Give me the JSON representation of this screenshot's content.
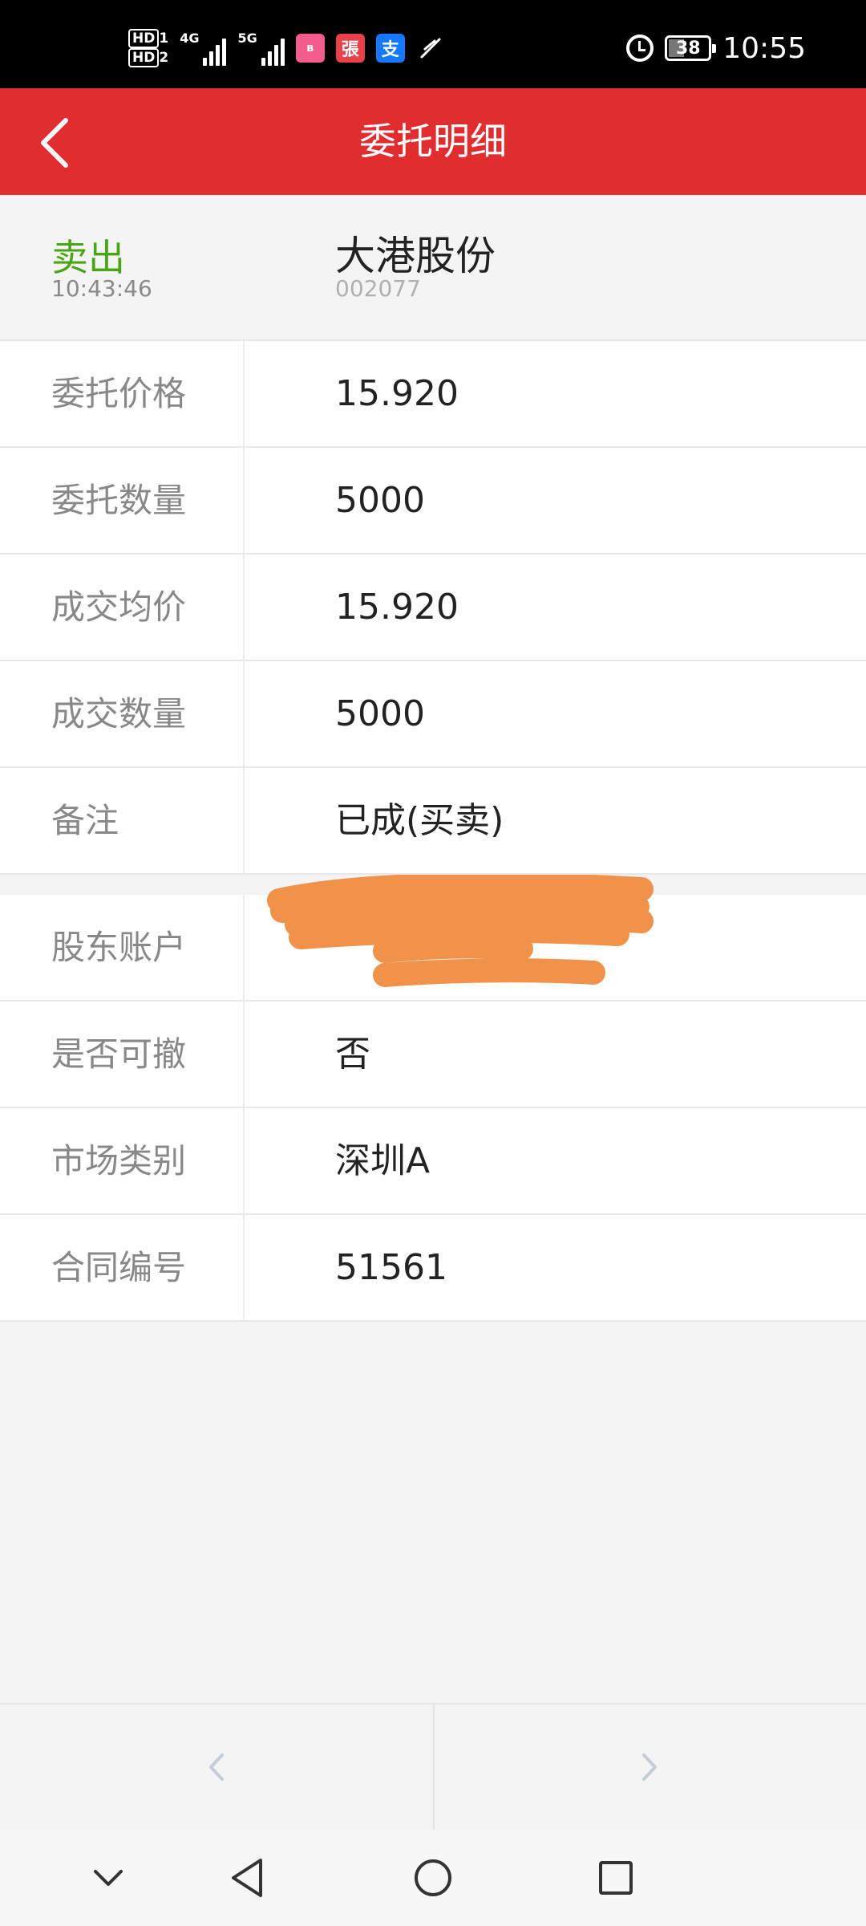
{
  "status_bar": {
    "hd1": "HD",
    "hd1_sub": "1",
    "hd2": "HD",
    "hd2_sub": "2",
    "net1": "4G",
    "net2": "5G",
    "app_icons": [
      "bilibili-icon",
      "zhang-app-icon",
      "alipay-icon",
      "feather-icon"
    ],
    "battery": "38",
    "time": "10:55"
  },
  "header": {
    "title": "委托明细",
    "back_icon": "chevron-left-icon"
  },
  "order": {
    "side": "卖出",
    "time": "10:43:46",
    "stock_name": "大港股份",
    "stock_code": "002077"
  },
  "details": [
    {
      "label": "委托价格",
      "value": "15.920"
    },
    {
      "label": "委托数量",
      "value": "5000"
    },
    {
      "label": "成交均价",
      "value": "15.920"
    },
    {
      "label": "成交数量",
      "value": "5000"
    },
    {
      "label": "备注",
      "value": "已成(买卖)"
    }
  ],
  "account": [
    {
      "label": "股东账户",
      "value": ""
    },
    {
      "label": "是否可撤",
      "value": "否"
    },
    {
      "label": "市场类别",
      "value": "深圳A"
    },
    {
      "label": "合同编号",
      "value": "51561"
    }
  ],
  "pager": {
    "prev_icon": "chevron-left-icon",
    "next_icon": "chevron-right-icon"
  },
  "nav": [
    "chevron-down-icon",
    "back-triangle-icon",
    "home-circle-icon",
    "recents-square-icon"
  ],
  "colors": {
    "brand_red": "#e12c30",
    "sell_green": "#4aa516",
    "redaction": "#f0924a"
  }
}
